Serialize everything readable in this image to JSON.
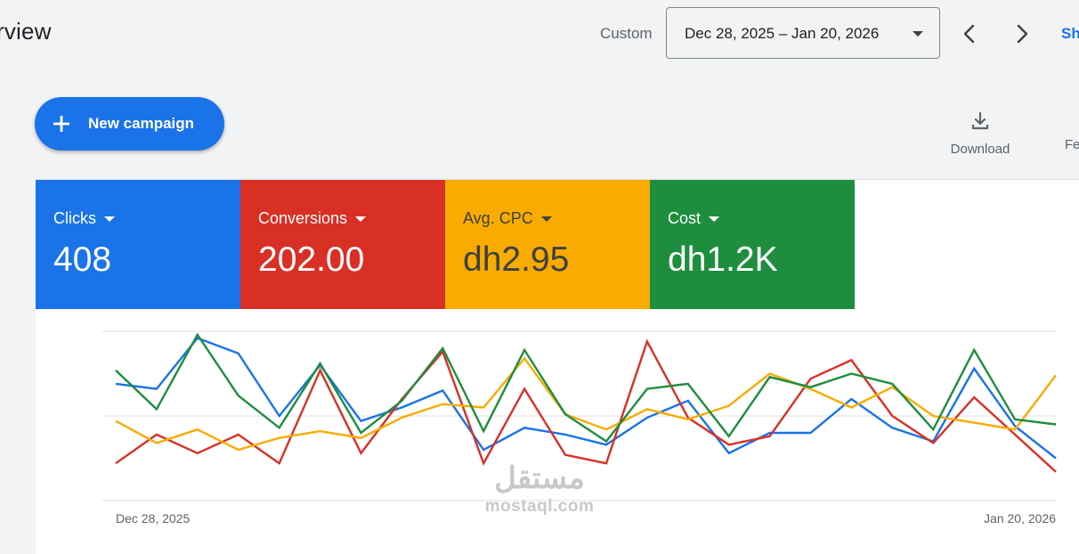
{
  "header": {
    "title": "rview",
    "range_type": "Custom",
    "date_range": "Dec 28, 2025 – Jan 20, 2026",
    "show_label": "Sh"
  },
  "toolbar": {
    "new_campaign_label": "New campaign",
    "download_label": "Download",
    "feedback_label": "Fe"
  },
  "metrics": [
    {
      "name": "Clicks",
      "value": "408",
      "color": "#1a73e8"
    },
    {
      "name": "Conversions",
      "value": "202.00",
      "color": "#d93025"
    },
    {
      "name": "Avg. CPC",
      "value": "dh2.95",
      "color": "#f9ab00"
    },
    {
      "name": "Cost",
      "value": "dh1.2K",
      "color": "#1e8e3e"
    }
  ],
  "chart_data": {
    "type": "line",
    "title": "",
    "xlabel": "",
    "ylabel": "",
    "x_tick_labels": [
      "Dec 28, 2025",
      "Jan 20, 2026"
    ],
    "x": [
      "Dec 28",
      "Dec 29",
      "Dec 30",
      "Dec 31",
      "Jan 1",
      "Jan 2",
      "Jan 3",
      "Jan 4",
      "Jan 5",
      "Jan 6",
      "Jan 7",
      "Jan 8",
      "Jan 9",
      "Jan 10",
      "Jan 11",
      "Jan 12",
      "Jan 13",
      "Jan 14",
      "Jan 15",
      "Jan 16",
      "Jan 17",
      "Jan 18",
      "Jan 19",
      "Jan 20"
    ],
    "grid": true,
    "ylim": [
      0,
      100
    ],
    "series": [
      {
        "name": "Clicks",
        "color": "#1a73e8",
        "values": [
          69,
          66,
          96,
          87,
          50,
          80,
          47,
          55,
          65,
          30,
          43,
          39,
          33,
          49,
          59,
          28,
          40,
          40,
          60,
          43,
          35,
          78,
          44,
          25
        ]
      },
      {
        "name": "Conversions",
        "color": "#d93025",
        "values": [
          22,
          39,
          28,
          39,
          22,
          77,
          28,
          60,
          88,
          22,
          66,
          27,
          22,
          94,
          49,
          33,
          38,
          72,
          83,
          50,
          34,
          61,
          39,
          17
        ]
      },
      {
        "name": "Avg. CPC",
        "color": "#f9ab00",
        "values": [
          47,
          34,
          42,
          30,
          37,
          41,
          37,
          49,
          57,
          55,
          84,
          51,
          42,
          54,
          48,
          56,
          75,
          66,
          55,
          67,
          50,
          46,
          42,
          74
        ]
      },
      {
        "name": "Cost",
        "color": "#1e8e3e",
        "values": [
          77,
          54,
          98,
          62,
          43,
          81,
          40,
          59,
          90,
          41,
          89,
          51,
          35,
          66,
          69,
          38,
          73,
          67,
          75,
          69,
          42,
          89,
          48,
          45
        ]
      }
    ]
  },
  "watermark": {
    "arabic": "مستقل",
    "latin": "mostaql.com"
  },
  "icons": [
    "chevron-left-icon",
    "chevron-right-icon",
    "plus-icon",
    "download-icon",
    "dropdown-caret-icon"
  ]
}
